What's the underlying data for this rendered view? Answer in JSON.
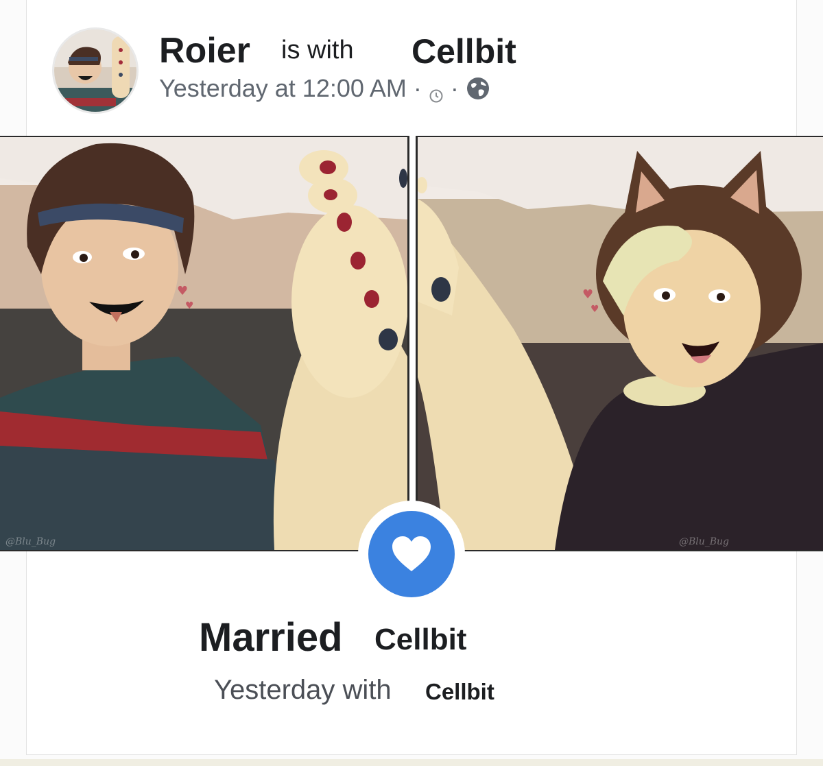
{
  "post": {
    "author": "Roier",
    "with_text": "is with",
    "tagged": "Cellbit",
    "timestamp": "Yesterday at 12:00 AM",
    "separator": "·"
  },
  "photos": {
    "left_watermark": "@Blu_Bug",
    "right_watermark": "@Blu_Bug"
  },
  "life_event": {
    "title": "Married",
    "partner": "Cellbit",
    "when": "Yesterday with",
    "with_name": "Cellbit"
  },
  "colors": {
    "badge": "#3b82e0",
    "text": "#1c1e21",
    "meta": "#606770"
  }
}
